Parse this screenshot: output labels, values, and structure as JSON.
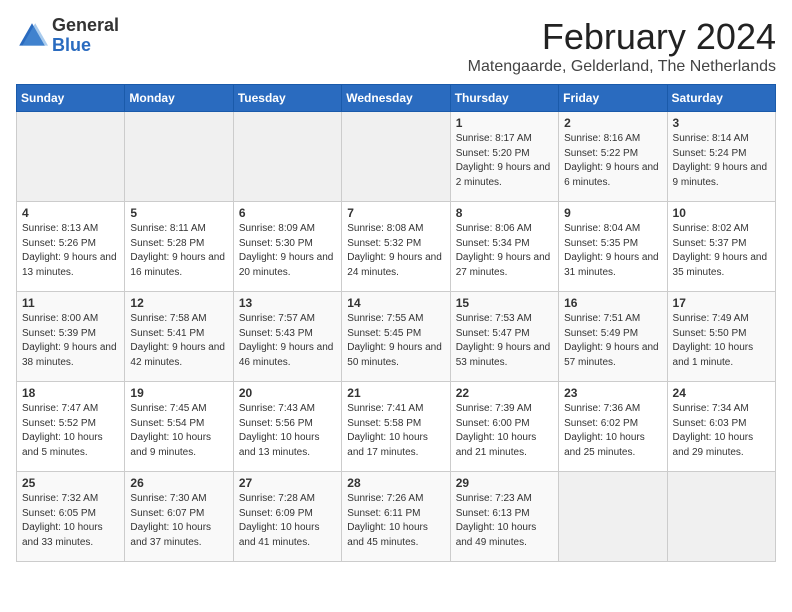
{
  "header": {
    "logo_general": "General",
    "logo_blue": "Blue",
    "title": "February 2024",
    "location": "Matengaarde, Gelderland, The Netherlands"
  },
  "days_of_week": [
    "Sunday",
    "Monday",
    "Tuesday",
    "Wednesday",
    "Thursday",
    "Friday",
    "Saturday"
  ],
  "weeks": [
    [
      {
        "day": "",
        "info": ""
      },
      {
        "day": "",
        "info": ""
      },
      {
        "day": "",
        "info": ""
      },
      {
        "day": "",
        "info": ""
      },
      {
        "day": "1",
        "info": "Sunrise: 8:17 AM\nSunset: 5:20 PM\nDaylight: 9 hours\nand 2 minutes."
      },
      {
        "day": "2",
        "info": "Sunrise: 8:16 AM\nSunset: 5:22 PM\nDaylight: 9 hours\nand 6 minutes."
      },
      {
        "day": "3",
        "info": "Sunrise: 8:14 AM\nSunset: 5:24 PM\nDaylight: 9 hours\nand 9 minutes."
      }
    ],
    [
      {
        "day": "4",
        "info": "Sunrise: 8:13 AM\nSunset: 5:26 PM\nDaylight: 9 hours\nand 13 minutes."
      },
      {
        "day": "5",
        "info": "Sunrise: 8:11 AM\nSunset: 5:28 PM\nDaylight: 9 hours\nand 16 minutes."
      },
      {
        "day": "6",
        "info": "Sunrise: 8:09 AM\nSunset: 5:30 PM\nDaylight: 9 hours\nand 20 minutes."
      },
      {
        "day": "7",
        "info": "Sunrise: 8:08 AM\nSunset: 5:32 PM\nDaylight: 9 hours\nand 24 minutes."
      },
      {
        "day": "8",
        "info": "Sunrise: 8:06 AM\nSunset: 5:34 PM\nDaylight: 9 hours\nand 27 minutes."
      },
      {
        "day": "9",
        "info": "Sunrise: 8:04 AM\nSunset: 5:35 PM\nDaylight: 9 hours\nand 31 minutes."
      },
      {
        "day": "10",
        "info": "Sunrise: 8:02 AM\nSunset: 5:37 PM\nDaylight: 9 hours\nand 35 minutes."
      }
    ],
    [
      {
        "day": "11",
        "info": "Sunrise: 8:00 AM\nSunset: 5:39 PM\nDaylight: 9 hours\nand 38 minutes."
      },
      {
        "day": "12",
        "info": "Sunrise: 7:58 AM\nSunset: 5:41 PM\nDaylight: 9 hours\nand 42 minutes."
      },
      {
        "day": "13",
        "info": "Sunrise: 7:57 AM\nSunset: 5:43 PM\nDaylight: 9 hours\nand 46 minutes."
      },
      {
        "day": "14",
        "info": "Sunrise: 7:55 AM\nSunset: 5:45 PM\nDaylight: 9 hours\nand 50 minutes."
      },
      {
        "day": "15",
        "info": "Sunrise: 7:53 AM\nSunset: 5:47 PM\nDaylight: 9 hours\nand 53 minutes."
      },
      {
        "day": "16",
        "info": "Sunrise: 7:51 AM\nSunset: 5:49 PM\nDaylight: 9 hours\nand 57 minutes."
      },
      {
        "day": "17",
        "info": "Sunrise: 7:49 AM\nSunset: 5:50 PM\nDaylight: 10 hours\nand 1 minute."
      }
    ],
    [
      {
        "day": "18",
        "info": "Sunrise: 7:47 AM\nSunset: 5:52 PM\nDaylight: 10 hours\nand 5 minutes."
      },
      {
        "day": "19",
        "info": "Sunrise: 7:45 AM\nSunset: 5:54 PM\nDaylight: 10 hours\nand 9 minutes."
      },
      {
        "day": "20",
        "info": "Sunrise: 7:43 AM\nSunset: 5:56 PM\nDaylight: 10 hours\nand 13 minutes."
      },
      {
        "day": "21",
        "info": "Sunrise: 7:41 AM\nSunset: 5:58 PM\nDaylight: 10 hours\nand 17 minutes."
      },
      {
        "day": "22",
        "info": "Sunrise: 7:39 AM\nSunset: 6:00 PM\nDaylight: 10 hours\nand 21 minutes."
      },
      {
        "day": "23",
        "info": "Sunrise: 7:36 AM\nSunset: 6:02 PM\nDaylight: 10 hours\nand 25 minutes."
      },
      {
        "day": "24",
        "info": "Sunrise: 7:34 AM\nSunset: 6:03 PM\nDaylight: 10 hours\nand 29 minutes."
      }
    ],
    [
      {
        "day": "25",
        "info": "Sunrise: 7:32 AM\nSunset: 6:05 PM\nDaylight: 10 hours\nand 33 minutes."
      },
      {
        "day": "26",
        "info": "Sunrise: 7:30 AM\nSunset: 6:07 PM\nDaylight: 10 hours\nand 37 minutes."
      },
      {
        "day": "27",
        "info": "Sunrise: 7:28 AM\nSunset: 6:09 PM\nDaylight: 10 hours\nand 41 minutes."
      },
      {
        "day": "28",
        "info": "Sunrise: 7:26 AM\nSunset: 6:11 PM\nDaylight: 10 hours\nand 45 minutes."
      },
      {
        "day": "29",
        "info": "Sunrise: 7:23 AM\nSunset: 6:13 PM\nDaylight: 10 hours\nand 49 minutes."
      },
      {
        "day": "",
        "info": ""
      },
      {
        "day": "",
        "info": ""
      }
    ]
  ]
}
